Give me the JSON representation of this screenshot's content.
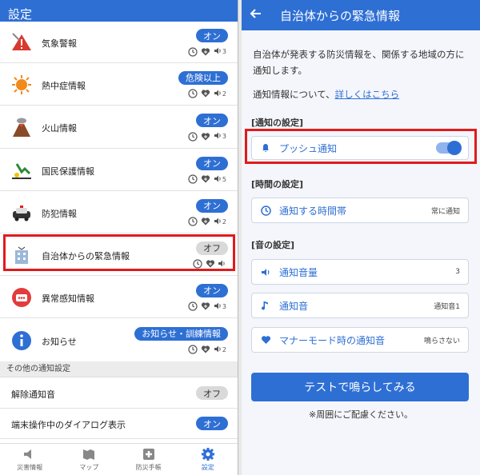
{
  "left": {
    "title": "設定",
    "rows": [
      {
        "label": "気象警報",
        "badge": "オン",
        "off": false,
        "vol": "3"
      },
      {
        "label": "熱中症情報",
        "badge": "危険以上",
        "off": false,
        "vol": "2"
      },
      {
        "label": "火山情報",
        "badge": "オン",
        "off": false,
        "vol": "3"
      },
      {
        "label": "国民保護情報",
        "badge": "オン",
        "off": false,
        "vol": "5"
      },
      {
        "label": "防犯情報",
        "badge": "オン",
        "off": false,
        "vol": "2"
      },
      {
        "label": "自治体からの緊急情報",
        "badge": "オフ",
        "off": true,
        "vol": ""
      },
      {
        "label": "異常感知情報",
        "badge": "オン",
        "off": false,
        "vol": "3"
      },
      {
        "label": "お知らせ",
        "badge": "お知らせ・訓練情報",
        "off": false,
        "vol": "2"
      }
    ],
    "section_other": "その他の通知設定",
    "other_rows": [
      {
        "label": "解除通知音",
        "badge": "オフ",
        "off": true
      },
      {
        "label": "端末操作中のダイアログ表示",
        "badge": "オン",
        "off": false
      }
    ],
    "nav": [
      {
        "label": "災害情報",
        "icon": "speaker-icon"
      },
      {
        "label": "マップ",
        "icon": "map-icon"
      },
      {
        "label": "防災手帳",
        "icon": "firstaid-icon"
      },
      {
        "label": "設定",
        "icon": "gear-icon"
      }
    ]
  },
  "right": {
    "title": "自治体からの緊急情報",
    "description": "自治体が発表する防災情報を、関係する地域の方に通知します。",
    "about_prefix": "通知情報について、",
    "about_link": "詳しくはこちら",
    "notify_section": "[通知の設定]",
    "push_label": "プッシュ通知",
    "push_on": true,
    "time_section": "[時間の設定]",
    "time_label": "通知する時間帯",
    "time_value": "常に通知",
    "sound_section": "[音の設定]",
    "volume_label": "通知音量",
    "volume_value": "3",
    "sound_label": "通知音",
    "sound_value": "通知音1",
    "manner_label": "マナーモード時の通知音",
    "manner_value": "鳴らさない",
    "test_button": "テストで鳴らしてみる",
    "note": "※周囲にご配慮ください。"
  },
  "colors": {
    "accent": "#2e6fd4",
    "highlight": "#e01b1b"
  }
}
